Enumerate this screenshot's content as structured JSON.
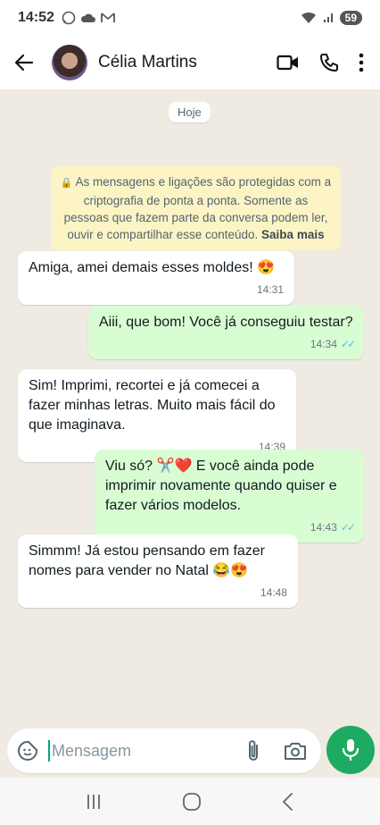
{
  "status_bar": {
    "time": "14:52",
    "battery": "59"
  },
  "header": {
    "contact_name": "Célia Martins"
  },
  "chat": {
    "date_chip": "Hoje",
    "notice": {
      "text": "As mensagens e ligações são protegidas com a criptografia de ponta a ponta. Somente as pessoas que fazem parte da conversa podem ler, ouvir e compartilhar esse conteúdo.",
      "link": "Saiba mais"
    },
    "messages": [
      {
        "direction": "in",
        "text": "Amiga, amei demais esses moldes! 😍",
        "time": "14:31"
      },
      {
        "direction": "out",
        "text": "Aiii, que bom! Você já conseguiu testar?",
        "time": "14:34"
      },
      {
        "direction": "in",
        "text": "Sim! Imprimi, recortei e já comecei a fazer minhas letras. Muito mais fácil do que imaginava.",
        "time": "14:39"
      },
      {
        "direction": "out",
        "text": "Viu só? ✂️❤️ E você ainda pode imprimir novamente quando quiser e fazer vários modelos.",
        "time": "14:43"
      },
      {
        "direction": "in",
        "text": "Simmm! Já estou pensando em fazer nomes para vender no Natal 😂😍",
        "time": "14:48"
      }
    ]
  },
  "input": {
    "placeholder": "Mensagem"
  },
  "colors": {
    "accent": "#1daa61",
    "outgoing_bubble": "#d9fdd3",
    "read_ticks": "#53bdeb"
  }
}
